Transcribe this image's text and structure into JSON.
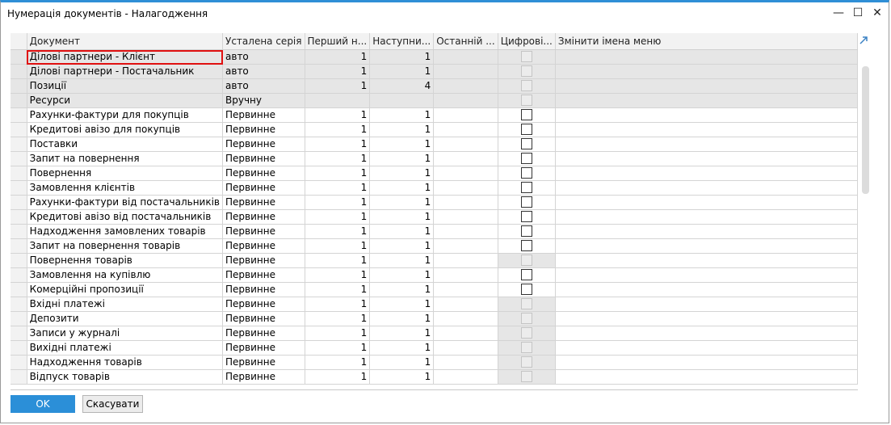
{
  "window": {
    "title": "Нумерація документів - Налагодження",
    "minimize_glyph": "—",
    "maximize_glyph": "☐",
    "close_glyph": "✕"
  },
  "grid": {
    "columns": [
      "",
      "Документ",
      "Усталена серія",
      "Перший н...",
      "Наступни...",
      "Останній ...",
      "Цифрові...",
      "Змінити імена меню"
    ],
    "rows": [
      {
        "doc": "Ділові партнери - Клієнт",
        "series": "авто",
        "first": "1",
        "next": "1",
        "last": "",
        "checkbox": "disabled",
        "gray": true,
        "selected": true
      },
      {
        "doc": "Ділові партнери - Постачальник",
        "series": "авто",
        "first": "1",
        "next": "1",
        "last": "",
        "checkbox": "disabled",
        "gray": true
      },
      {
        "doc": "Позиції",
        "series": "авто",
        "first": "1",
        "next": "4",
        "last": "",
        "checkbox": "disabled",
        "gray": true
      },
      {
        "doc": "Ресурси",
        "series": "Вручну",
        "first": "",
        "next": "",
        "last": "",
        "checkbox": "disabled",
        "gray": true
      },
      {
        "doc": "Рахунки-фактури для покупців",
        "series": "Первинне",
        "first": "1",
        "next": "1",
        "last": "",
        "checkbox": "enabled"
      },
      {
        "doc": "Кредитові авізо для покупців",
        "series": "Первинне",
        "first": "1",
        "next": "1",
        "last": "",
        "checkbox": "enabled"
      },
      {
        "doc": "Поставки",
        "series": "Первинне",
        "first": "1",
        "next": "1",
        "last": "",
        "checkbox": "enabled"
      },
      {
        "doc": "Запит на повернення",
        "series": "Первинне",
        "first": "1",
        "next": "1",
        "last": "",
        "checkbox": "enabled"
      },
      {
        "doc": "Повернення",
        "series": "Первинне",
        "first": "1",
        "next": "1",
        "last": "",
        "checkbox": "enabled"
      },
      {
        "doc": "Замовлення клієнтів",
        "series": "Первинне",
        "first": "1",
        "next": "1",
        "last": "",
        "checkbox": "enabled"
      },
      {
        "doc": "Рахунки-фактури від постачальників",
        "series": "Первинне",
        "first": "1",
        "next": "1",
        "last": "",
        "checkbox": "enabled"
      },
      {
        "doc": "Кредитові авізо від постачальників",
        "series": "Первинне",
        "first": "1",
        "next": "1",
        "last": "",
        "checkbox": "enabled"
      },
      {
        "doc": "Надходження замовлених товарів",
        "series": "Первинне",
        "first": "1",
        "next": "1",
        "last": "",
        "checkbox": "enabled"
      },
      {
        "doc": "Запит на повернення товарів",
        "series": "Первинне",
        "first": "1",
        "next": "1",
        "last": "",
        "checkbox": "enabled"
      },
      {
        "doc": "Повернення товарів",
        "series": "Первинне",
        "first": "1",
        "next": "1",
        "last": "",
        "checkbox": "disabled"
      },
      {
        "doc": "Замовлення на купівлю",
        "series": "Первинне",
        "first": "1",
        "next": "1",
        "last": "",
        "checkbox": "enabled"
      },
      {
        "doc": "Комерційні пропозиції",
        "series": "Первинне",
        "first": "1",
        "next": "1",
        "last": "",
        "checkbox": "enabled"
      },
      {
        "doc": "Вхідні платежі",
        "series": "Первинне",
        "first": "1",
        "next": "1",
        "last": "",
        "checkbox": "disabled"
      },
      {
        "doc": "Депозити",
        "series": "Первинне",
        "first": "1",
        "next": "1",
        "last": "",
        "checkbox": "disabled"
      },
      {
        "doc": "Записи у журналі",
        "series": "Первинне",
        "first": "1",
        "next": "1",
        "last": "",
        "checkbox": "disabled"
      },
      {
        "doc": "Вихідні платежі",
        "series": "Первинне",
        "first": "1",
        "next": "1",
        "last": "",
        "checkbox": "disabled"
      },
      {
        "doc": "Надходження товарів",
        "series": "Первинне",
        "first": "1",
        "next": "1",
        "last": "",
        "checkbox": "disabled"
      },
      {
        "doc": "Відпуск товарів",
        "series": "Первинне",
        "first": "1",
        "next": "1",
        "last": "",
        "checkbox": "disabled"
      }
    ]
  },
  "buttons": {
    "ok": "OK",
    "cancel": "Скасувати"
  },
  "colors": {
    "accent": "#2b8fd8",
    "selection_outline": "#e01010",
    "row_gray": "#e6e6e6"
  },
  "icons": {
    "expand": "expand-arrow-icon"
  }
}
